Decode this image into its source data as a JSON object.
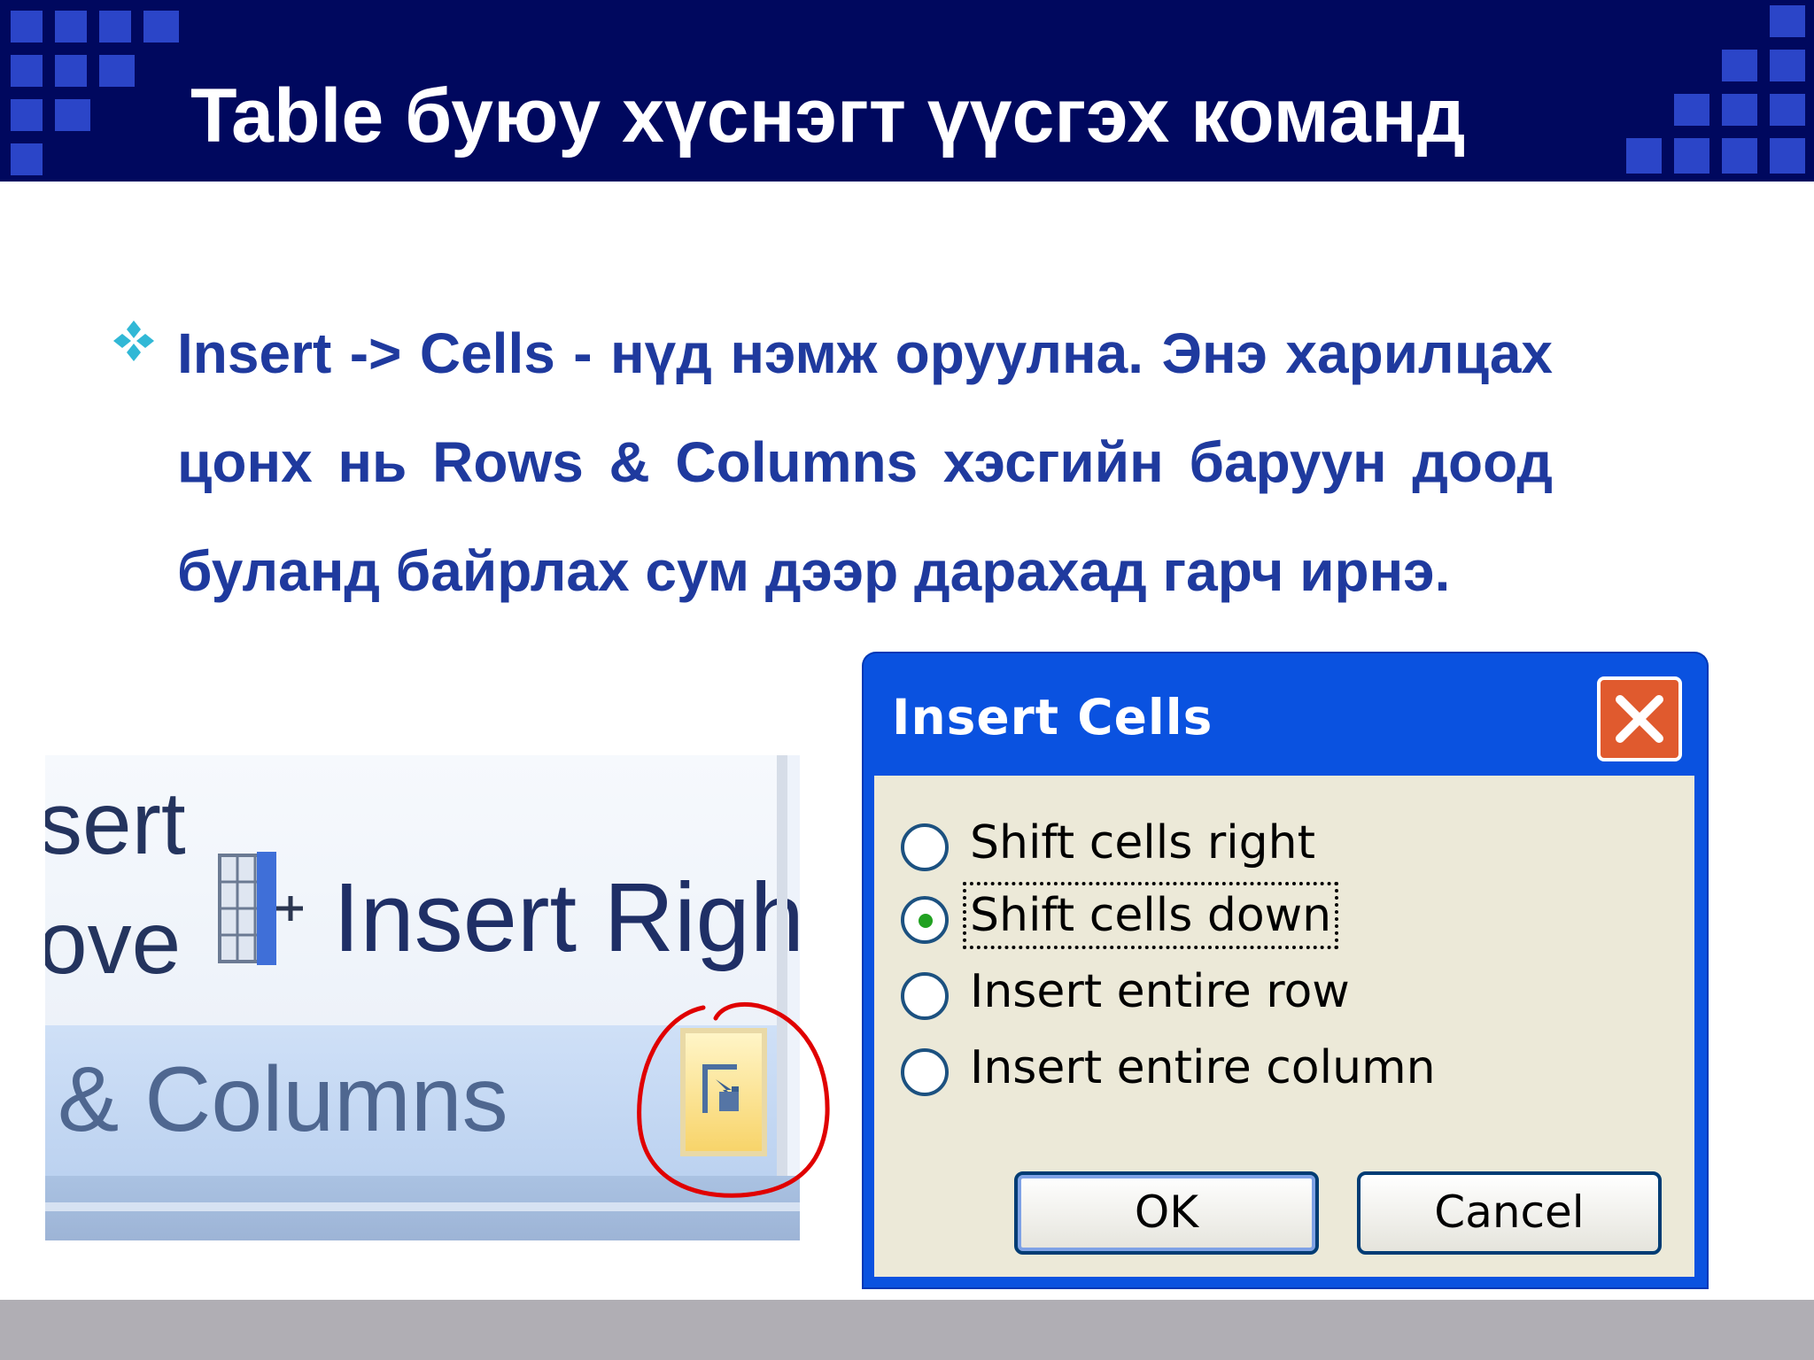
{
  "slide": {
    "title": "Table буюу хүснэгт үүсгэх команд",
    "paragraph": "Insert -> Cells - нүд нэмж оруулна. Энэ харилцах цонх нь Rows & Columns хэсгийн баруун доод буланд байрлах сум дээр дарахад гарч ирнэ.",
    "bullet_icon": "four-diamond-bullet-icon"
  },
  "ribbon": {
    "fragment_insert": "sert",
    "fragment_above": "ove",
    "insert_right_label": "Insert Right",
    "group_label": "& Columns",
    "launcher_icon": "dialog-launcher-icon",
    "table_icon": "insert-column-right-icon",
    "highlight_color": "#e00000"
  },
  "dialog": {
    "title": "Insert Cells",
    "close_icon": "close-icon",
    "options": [
      {
        "label": "Shift cells right",
        "selected": false
      },
      {
        "label": "Shift cells down",
        "selected": true
      },
      {
        "label": "Insert entire row",
        "selected": false
      },
      {
        "label": "Insert entire column",
        "selected": false
      }
    ],
    "ok_label": "OK",
    "cancel_label": "Cancel",
    "title_bar_color": "#0a52e0",
    "body_color": "#ece9d8"
  },
  "theme": {
    "header_bg": "#00085e",
    "accent_square": "#2b45c8",
    "text_color": "#1f3a9e"
  }
}
